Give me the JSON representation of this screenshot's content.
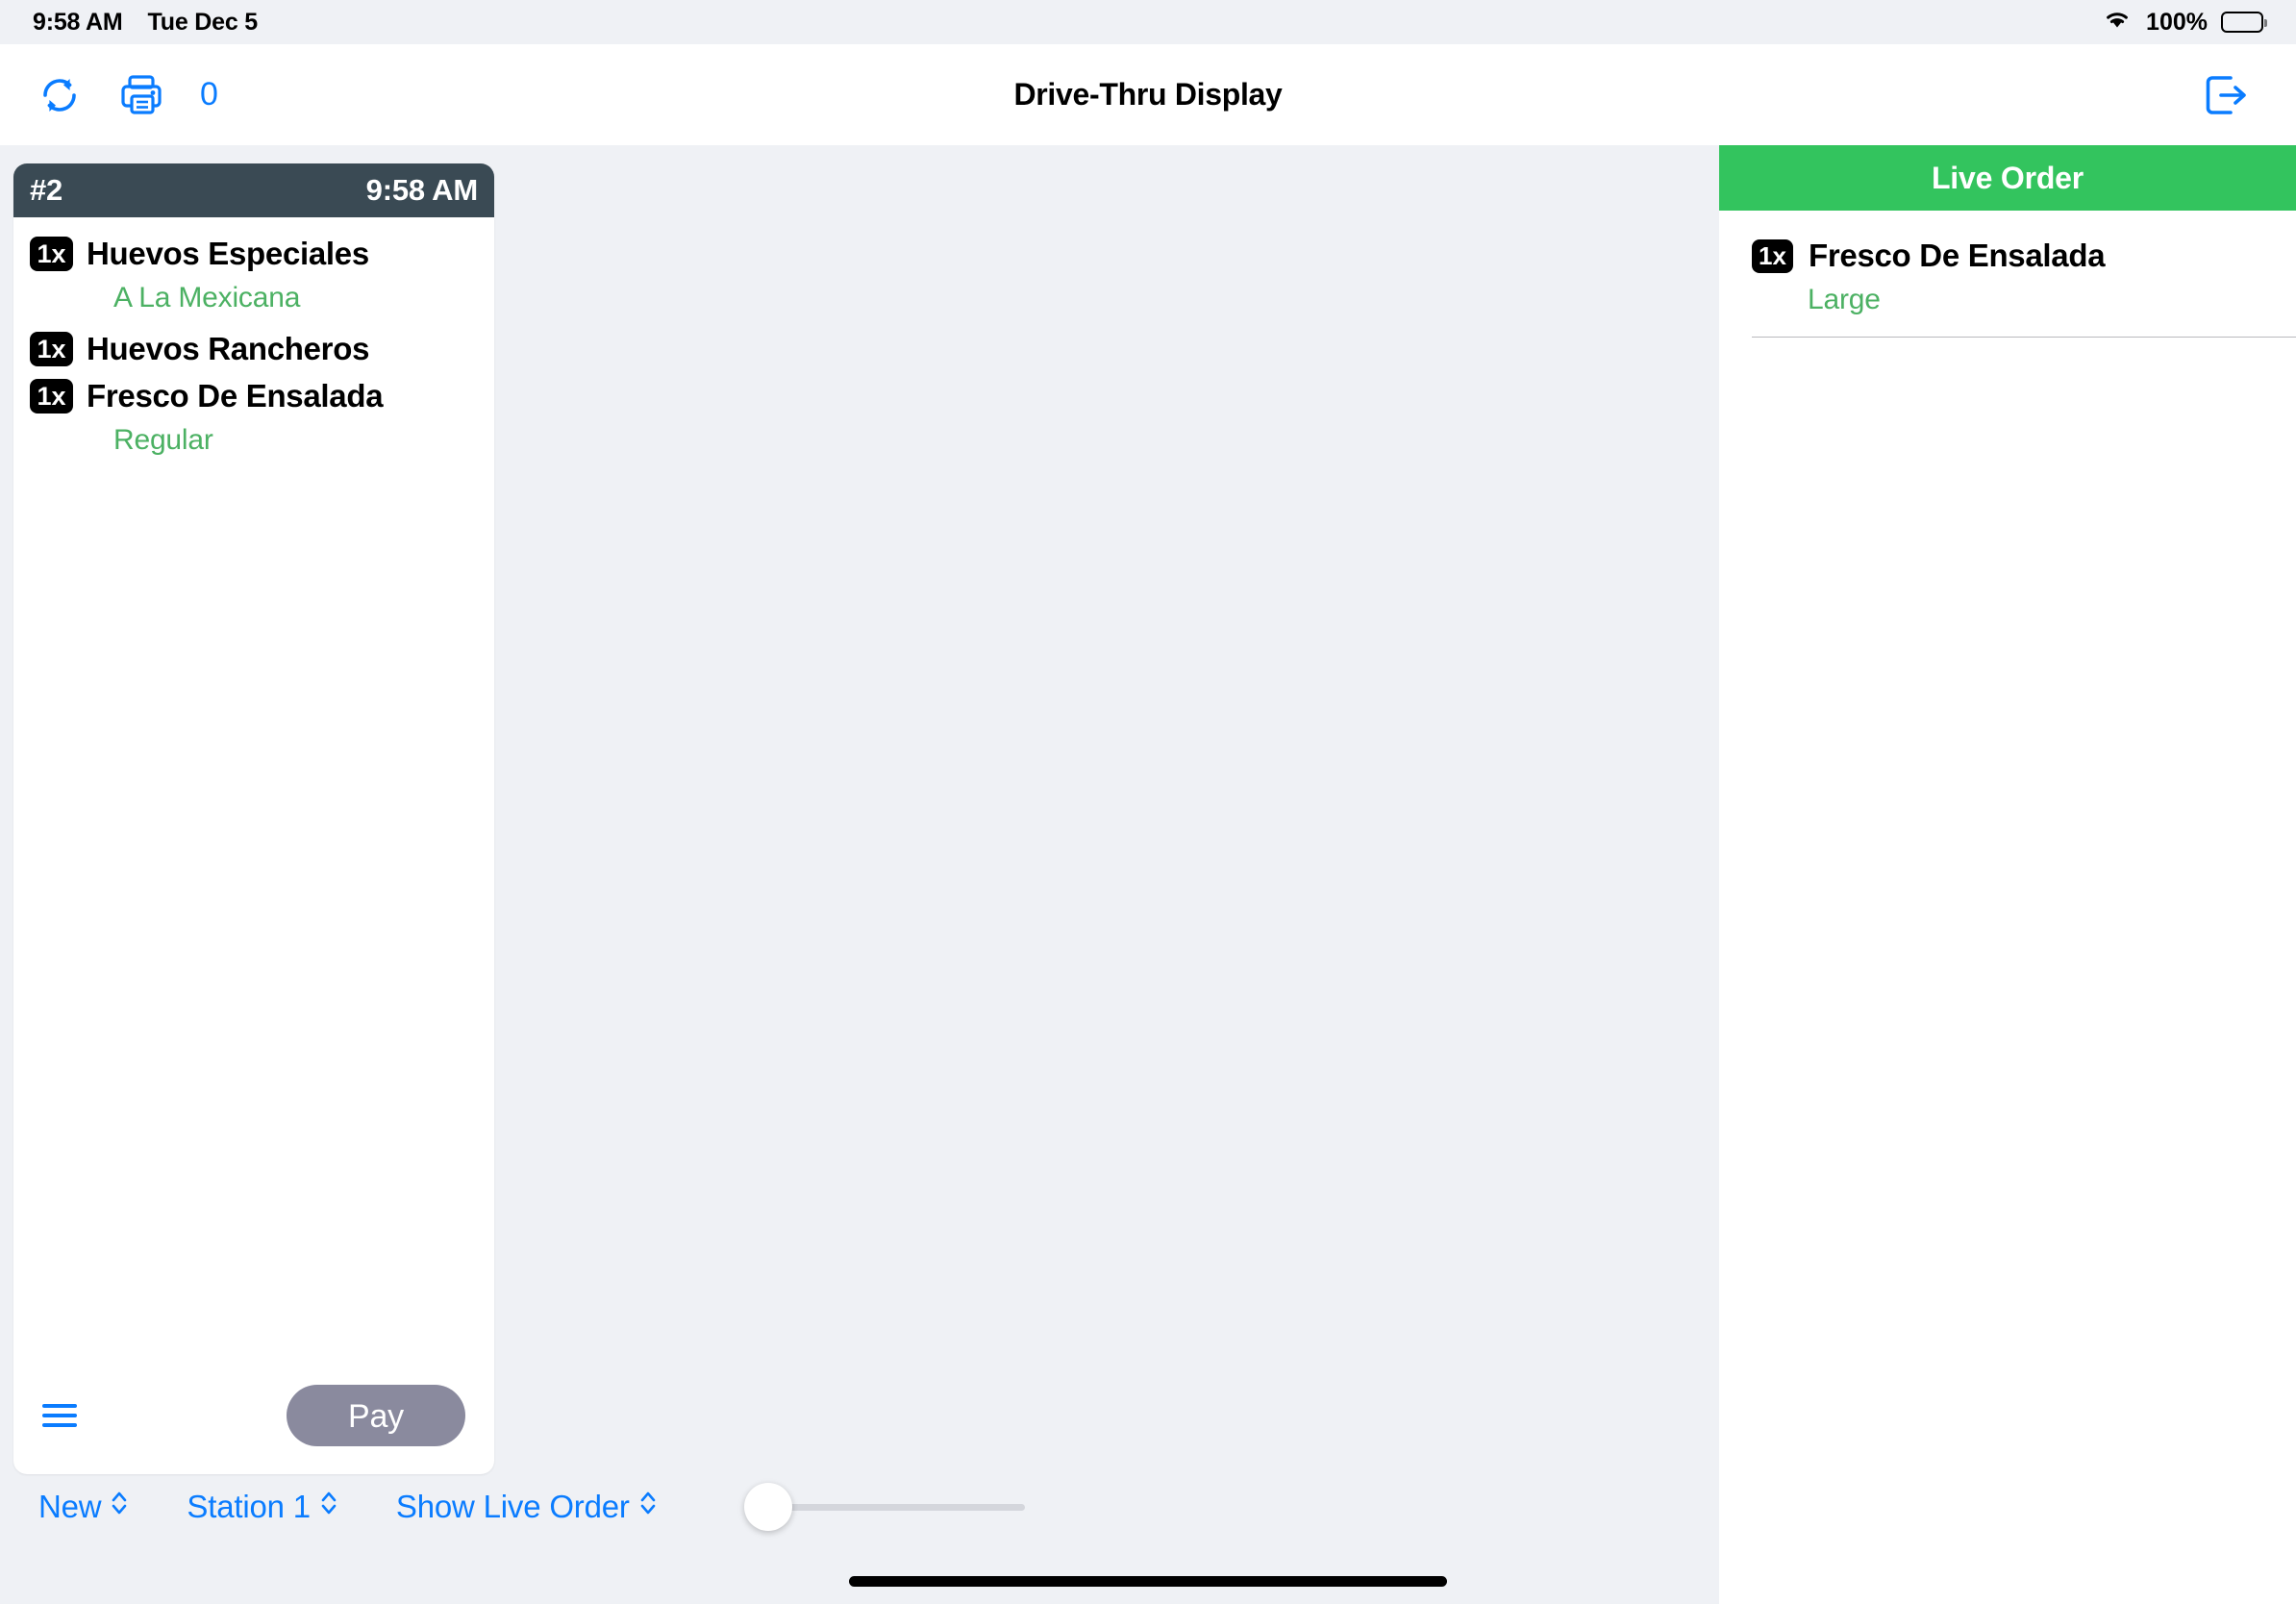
{
  "status_bar": {
    "time": "9:58 AM",
    "date": "Tue Dec 5",
    "battery_percent": "100%",
    "wifi_icon": "wifi-icon",
    "battery_icon": "battery-full-icon"
  },
  "nav_bar": {
    "title": "Drive-Thru Display",
    "refresh_icon": "refresh-icon",
    "printer_icon": "printer-icon",
    "print_queue_count": "0",
    "exit_icon": "exit-icon"
  },
  "order_card": {
    "order_number": "#2",
    "time": "9:58 AM",
    "items": [
      {
        "qty": "1x",
        "name": "Huevos Especiales",
        "modifier": "A La Mexicana"
      },
      {
        "qty": "1x",
        "name": "Huevos Rancheros",
        "modifier": ""
      },
      {
        "qty": "1x",
        "name": "Fresco De Ensalada",
        "modifier": "Regular"
      }
    ],
    "menu_icon": "hamburger-menu-icon",
    "pay_label": "Pay"
  },
  "live_order": {
    "title": "Live Order",
    "items": [
      {
        "qty": "1x",
        "name": "Fresco De Ensalada",
        "modifier": "Large"
      }
    ]
  },
  "bottom_bar": {
    "filter_picker": "New",
    "station_picker": "Station 1",
    "live_order_picker": "Show Live Order",
    "slider_value": "0"
  },
  "colors": {
    "accent_blue": "#0a7cff",
    "green": "#33c45e",
    "modifier_green": "#4cb163",
    "card_header": "#3a4a54",
    "pay_button": "#8a8a9e",
    "page_background": "#eff1f5"
  }
}
